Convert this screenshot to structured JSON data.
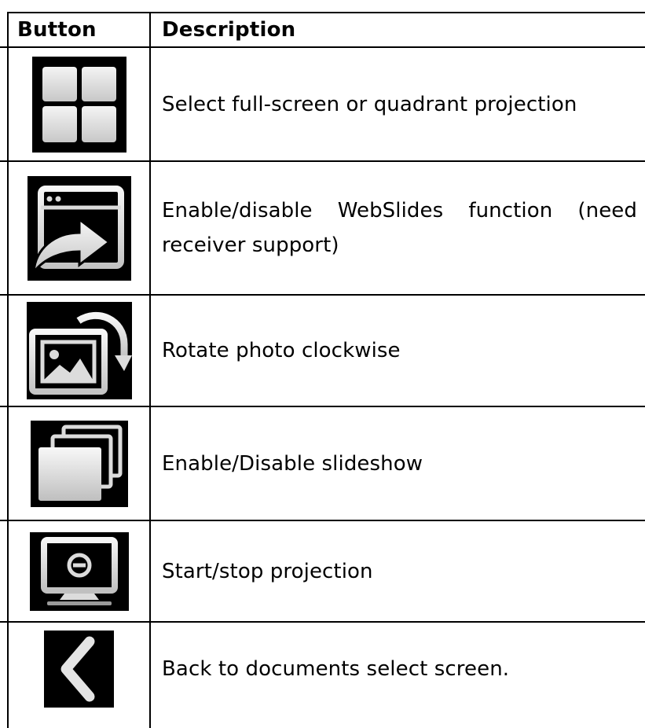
{
  "table": {
    "headers": {
      "button": "Button",
      "description": "Description"
    },
    "rows": [
      {
        "icon": "quadrant-grid-icon",
        "description": "Select full-screen or quadrant projection"
      },
      {
        "icon": "webslides-window-arrow-icon",
        "description": "Enable/disable WebSlides function (need receiver support)"
      },
      {
        "icon": "rotate-photo-icon",
        "description": "Rotate photo clockwise"
      },
      {
        "icon": "slideshow-stack-icon",
        "description": "Enable/Disable slideshow"
      },
      {
        "icon": "monitor-stop-icon",
        "description": "Start/stop projection"
      },
      {
        "icon": "back-chevron-icon",
        "description": "Back to documents select screen."
      }
    ]
  },
  "colors": {
    "icon_background": "#000000",
    "icon_foreground": "#dcdcdc",
    "text": "#000000",
    "border": "#000000"
  }
}
